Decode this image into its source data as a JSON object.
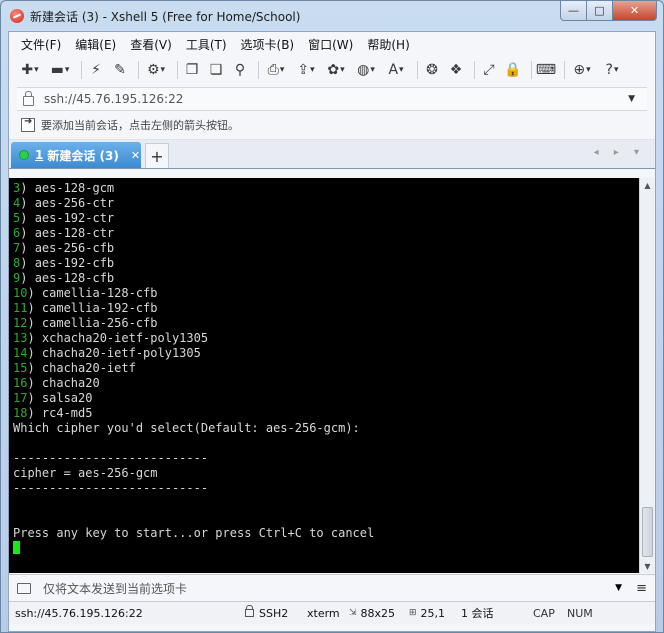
{
  "window": {
    "title": "新建会话 (3) - Xshell 5 (Free for Home/School)",
    "min_glyph": "—",
    "max_glyph": "□",
    "close_glyph": "✕"
  },
  "menubar": {
    "items": [
      "文件(F)",
      "编辑(E)",
      "查看(V)",
      "工具(T)",
      "选项卡(B)",
      "窗口(W)",
      "帮助(H)"
    ]
  },
  "toolbar": {
    "icons": {
      "new": "✚",
      "open": "▬",
      "connect": "⚡",
      "disconnect": "✎",
      "properties": "⚙",
      "copy": "❐",
      "paste": "❏",
      "find": "⚲",
      "print": "⎙",
      "transfer": "⇪",
      "settings": "✿",
      "globe": "◍",
      "font": "A",
      "xftp": "❂",
      "xagent": "❖",
      "fullscreen": "⤢",
      "lock": "🔒",
      "keyboard": "⌨",
      "newtab": "⊕",
      "help": "?"
    }
  },
  "address": {
    "value": "ssh://45.76.195.126:22"
  },
  "hint": {
    "text": "要添加当前会话，点击左侧的箭头按钮。"
  },
  "tabs": [
    {
      "number": "1",
      "label": "新建会话 (3)",
      "close": "✕"
    }
  ],
  "tab_add": "+",
  "tab_nav": "◂ ▸ ▾",
  "terminal": {
    "options": [
      {
        "n": "3",
        "v": "aes-128-gcm"
      },
      {
        "n": "4",
        "v": "aes-256-ctr"
      },
      {
        "n": "5",
        "v": "aes-192-ctr"
      },
      {
        "n": "6",
        "v": "aes-128-ctr"
      },
      {
        "n": "7",
        "v": "aes-256-cfb"
      },
      {
        "n": "8",
        "v": "aes-192-cfb"
      },
      {
        "n": "9",
        "v": "aes-128-cfb"
      },
      {
        "n": "10",
        "v": "camellia-128-cfb"
      },
      {
        "n": "11",
        "v": "camellia-192-cfb"
      },
      {
        "n": "12",
        "v": "camellia-256-cfb"
      },
      {
        "n": "13",
        "v": "xchacha20-ietf-poly1305"
      },
      {
        "n": "14",
        "v": "chacha20-ietf-poly1305"
      },
      {
        "n": "15",
        "v": "chacha20-ietf"
      },
      {
        "n": "16",
        "v": "chacha20"
      },
      {
        "n": "17",
        "v": "salsa20"
      },
      {
        "n": "18",
        "v": "rc4-md5"
      }
    ],
    "prompt": "Which cipher you'd select(Default: aes-256-gcm):",
    "separator": "---------------------------",
    "selected": "cipher = aes-256-gcm",
    "press_key": "Press any key to start...or press Ctrl+C to cancel"
  },
  "sendbar": {
    "placeholder": "仅将文本发送到当前选项卡",
    "menu_glyph": "≡"
  },
  "status": {
    "connection": "ssh://45.76.195.126:22",
    "protocol": "SSH2",
    "terminal_type": "xterm",
    "size": "88x25",
    "cursor_pos": "25,1",
    "sessions": "1 会话",
    "caps": "CAP",
    "num": "NUM"
  }
}
